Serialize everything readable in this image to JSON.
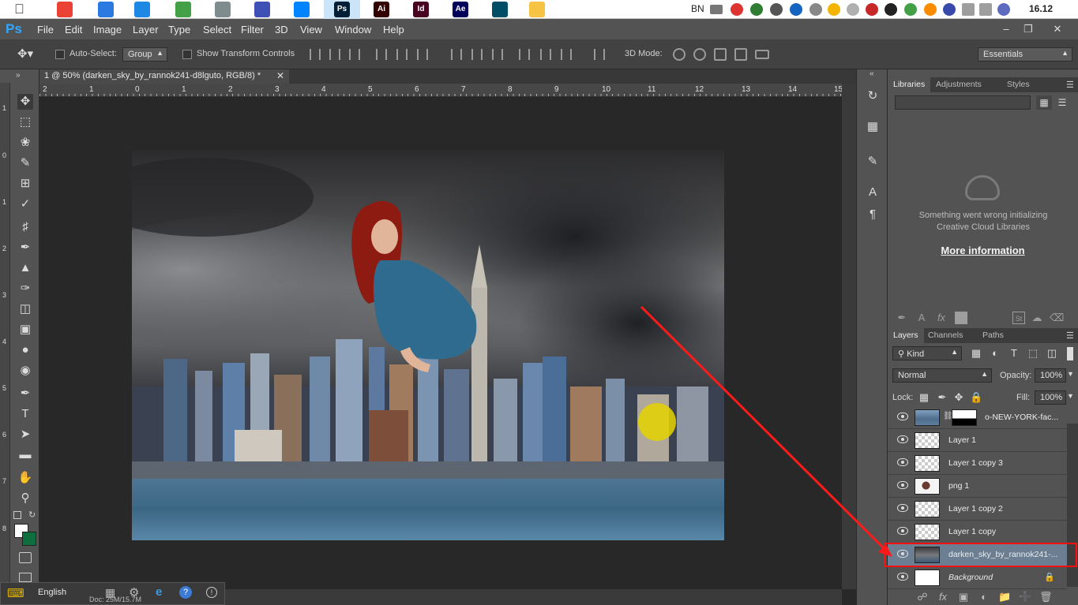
{
  "taskbar": {
    "language": "BN",
    "clock": "16.12",
    "apps": [
      {
        "name": "chrome-icon",
        "color": "#ea4335"
      },
      {
        "name": "video-app-icon",
        "color": "#2a7ae2"
      },
      {
        "name": "media-player-icon",
        "color": "#1e88e5"
      },
      {
        "name": "globe-app-icon",
        "color": "#43a047"
      },
      {
        "name": "camera-app-icon",
        "color": "#7f8c8d"
      },
      {
        "name": "tool-app-icon",
        "color": "#3f51b5"
      },
      {
        "name": "messenger-icon",
        "color": "#0084ff"
      },
      {
        "name": "photoshop-taskbar-icon",
        "color": "#001e36",
        "label": "Ps"
      },
      {
        "name": "illustrator-taskbar-icon",
        "color": "#330000",
        "label": "Ai"
      },
      {
        "name": "indesign-taskbar-icon",
        "color": "#49021f",
        "label": "Id"
      },
      {
        "name": "after-effects-taskbar-icon",
        "color": "#00005b",
        "label": "Ae"
      },
      {
        "name": "terminal-app-icon",
        "color": "#004d66"
      },
      {
        "name": "folder-app-icon",
        "color": "#f6c343"
      }
    ]
  },
  "menubar": {
    "logo": "Ps",
    "items": [
      "File",
      "Edit",
      "Image",
      "Layer",
      "Type",
      "Select",
      "Filter",
      "3D",
      "View",
      "Window",
      "Help"
    ],
    "minimize": "–",
    "restore": "❐",
    "close": "✕"
  },
  "options_bar": {
    "auto_select_label": "Auto-Select:",
    "auto_select_value": "Group",
    "show_transform_label": "Show Transform Controls",
    "mode_3d_label": "3D Mode:",
    "workspace": "Essentials"
  },
  "document": {
    "tab_title": "1 @ 50% (darken_sky_by_rannok241-d8lguto, RGB/8) *",
    "ruler_labels": [
      "2",
      "1",
      "0",
      "1",
      "2",
      "3",
      "4",
      "5",
      "6",
      "7",
      "8",
      "9",
      "10",
      "11",
      "12",
      "13",
      "14",
      "15"
    ],
    "vruler_labels": [
      "1",
      "0",
      "1",
      "2",
      "3",
      "4",
      "5",
      "6",
      "7",
      "8"
    ]
  },
  "libraries_panel": {
    "tabs": [
      "Libraries",
      "Adjustments",
      "Styles"
    ],
    "message": "Something went wrong initializing Creative Cloud Libraries",
    "link": "More information"
  },
  "layers_panel": {
    "tabs": [
      "Layers",
      "Channels",
      "Paths"
    ],
    "filter_kind": "Kind",
    "blend_mode": "Normal",
    "opacity_label": "Opacity:",
    "opacity_value": "100%",
    "lock_label": "Lock:",
    "fill_label": "Fill:",
    "fill_value": "100%",
    "layers": [
      {
        "name": "o-NEW-YORK-fac...",
        "kind": "masked"
      },
      {
        "name": "Layer 1",
        "kind": "transparent"
      },
      {
        "name": "Layer 1 copy 3",
        "kind": "transparent"
      },
      {
        "name": "png 1",
        "kind": "figure"
      },
      {
        "name": "Layer 1 copy 2",
        "kind": "transparent"
      },
      {
        "name": "Layer 1 copy",
        "kind": "transparent"
      },
      {
        "name": "darken_sky_by_rannok241-...",
        "kind": "image",
        "selected": true
      },
      {
        "name": "Background",
        "kind": "white",
        "locked": true
      }
    ]
  },
  "os_language_bar": {
    "language": "English"
  },
  "status": {
    "doc_size": "Doc: 25M/15.7M"
  },
  "annotation": {
    "arrow_color": "#ff1a1a",
    "cursor_highlight_color": "#e5d400"
  }
}
